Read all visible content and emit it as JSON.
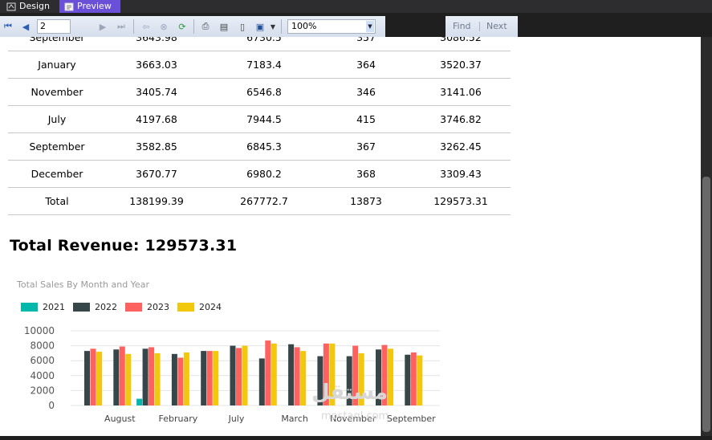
{
  "tabs": {
    "design": "Design",
    "preview": "Preview"
  },
  "toolbar": {
    "page_value": "2",
    "page_of": "",
    "zoom": "100%",
    "find_label": "Find",
    "next_label": "Next"
  },
  "table": {
    "partial_row": [
      "September",
      "3643.98",
      "6730.5",
      "357",
      "3086.52"
    ],
    "rows": [
      [
        "January",
        "3663.03",
        "7183.4",
        "364",
        "3520.37"
      ],
      [
        "November",
        "3405.74",
        "6546.8",
        "346",
        "3141.06"
      ],
      [
        "July",
        "4197.68",
        "7944.5",
        "415",
        "3746.82"
      ],
      [
        "September",
        "3582.85",
        "6845.3",
        "367",
        "3262.45"
      ],
      [
        "December",
        "3670.77",
        "6980.2",
        "368",
        "3309.43"
      ]
    ],
    "total_row": [
      "Total",
      "138199.39",
      "267772.7",
      "13873",
      "129573.31"
    ]
  },
  "summary": {
    "total_revenue": "Total Revenue: 129573.31"
  },
  "chart_data": {
    "type": "bar",
    "title": "Total Sales By Month and Year",
    "categories": [
      "",
      "August",
      "",
      "February",
      "",
      "July",
      "",
      "March",
      "",
      "November",
      "",
      "September"
    ],
    "series": [
      {
        "name": "2021",
        "color": "#01b8aa",
        "values": [
          0,
          0,
          900,
          0,
          0,
          0,
          0,
          0,
          0,
          0,
          0,
          0
        ]
      },
      {
        "name": "2022",
        "color": "#374649",
        "values": [
          7300,
          7500,
          7600,
          6900,
          7300,
          8000,
          6300,
          8200,
          6600,
          6600,
          7500,
          6800
        ]
      },
      {
        "name": "2023",
        "color": "#fd625e",
        "values": [
          7600,
          7900,
          7800,
          6400,
          7300,
          7700,
          8700,
          7800,
          8300,
          8000,
          8100,
          7100
        ]
      },
      {
        "name": "2024",
        "color": "#f2c80f",
        "values": [
          7200,
          6900,
          7000,
          7100,
          7300,
          8000,
          8300,
          7300,
          8300,
          7000,
          7600,
          6700
        ]
      }
    ],
    "ylim": [
      0,
      10000
    ],
    "yticks": [
      "10000",
      "8000",
      "6000",
      "4000",
      "2000",
      "0"
    ],
    "grid": true,
    "legend_position": "top-left"
  },
  "watermark": {
    "line1": "مستقل",
    "line2": "mostaql.com"
  }
}
